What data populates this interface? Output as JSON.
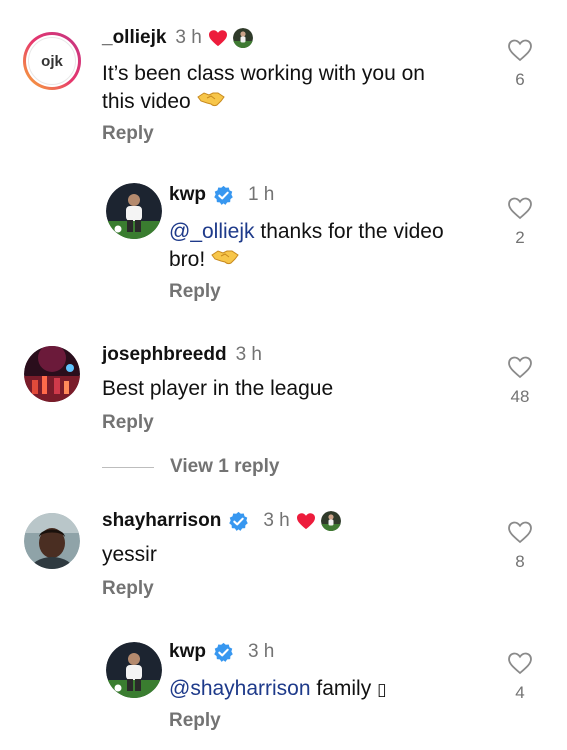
{
  "comments": [
    {
      "username": "_olliejk",
      "avatar_text": "ojk",
      "time": "3 h",
      "liked_by_creator": true,
      "text": "It’s been class working with you on this video",
      "text_line2": "this video",
      "reply_label": "Reply",
      "likes": "6"
    },
    {
      "username": "kwp",
      "verified": true,
      "time": "1 h",
      "mention": "@_olliejk",
      "text": " thanks for the video",
      "text_line2": "bro!",
      "reply_label": "Reply",
      "likes": "2"
    },
    {
      "username": "josephbreedd",
      "time": "3 h",
      "text": "Best player in the league",
      "reply_label": "Reply",
      "likes": "48",
      "view_replies_label": "View 1 reply"
    },
    {
      "username": "shayharrison",
      "verified": true,
      "time": "3 h",
      "liked_by_creator": true,
      "text": "yessir",
      "reply_label": "Reply",
      "likes": "8"
    },
    {
      "username": "kwp",
      "verified": true,
      "time": "3 h",
      "mention": "@shayharrison",
      "text": " family ",
      "trailing_glyph": "▯",
      "reply_label": "Reply",
      "likes": "4"
    }
  ],
  "colors": {
    "heart": "#ed1c3c",
    "verified": "#3797f0",
    "secondary_text": "#737373",
    "mention": "#1e3a8a"
  },
  "icons": {
    "like": "heart-outline-icon",
    "verified": "verified-badge-icon",
    "creator_like": "heart-filled-icon",
    "emoji": "handshake-emoji"
  }
}
